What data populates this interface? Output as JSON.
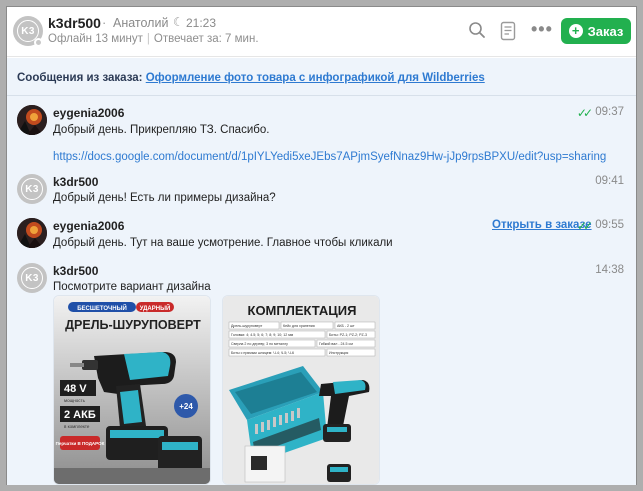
{
  "header": {
    "name": "k3dr500",
    "separator": "·",
    "real_name": "Анатолий",
    "moon_icon": "moon-icon",
    "local_time": "21:23",
    "status": "Офлайн 13 минут",
    "response": "Отвечает за: 7 мин.",
    "avatar_text": "K3",
    "order_button": "Заказ"
  },
  "order_ref": {
    "label": "Сообщения из заказа:",
    "link": "Оформление фото товара с инфографикой для Wildberries"
  },
  "messages": [
    {
      "author": "eygenia2006",
      "time": "09:37",
      "text": "Добрый день. Прикрепляю ТЗ. Спасибо.",
      "link": "https://docs.google.com/document/d/1pIYLYedi5xeJEbs7APjmSyefNnaz9Hw-jJp9rpsBPXU/edit?usp=sharing"
    },
    {
      "author": "k3dr500",
      "avatar_text": "K3",
      "time": "09:41",
      "text": "Добрый день! Есть ли примеры дизайна?"
    },
    {
      "author": "eygenia2006",
      "time": "09:55",
      "open_order": "Открыть в заказе",
      "text": "Добрый день. Тут на ваше усмотрение. Главное чтобы кликали"
    },
    {
      "author": "k3dr500",
      "avatar_text": "K3",
      "time": "14:38",
      "text": "Посмотрите вариант дизайна"
    }
  ],
  "images": {
    "drill": {
      "badge_left": "БЕСШЕТОЧНЫЙ",
      "badge_right": "УДАРНЫЙ",
      "title": "ДРЕЛЬ-ШУРУПОВЕРТ",
      "volt": "48 V",
      "volt_sub": "мощность",
      "akb": "2 АКБ",
      "akb_sub": "в комплекте",
      "plus": "+24",
      "gift": "Перчатки В ПОДАРОК"
    },
    "kit": {
      "title": "КОМПЛЕКТАЦИЯ",
      "rows": [
        [
          "Дрель-шуруповерт",
          "Кейс для хранения",
          "АКБ - 2 шт"
        ],
        [
          "Головки: 4; 4.5; 5; 6; 7; 8; 9; 10; 12 мм",
          "Биты: PZ-1; PZ-2; PZ-3"
        ],
        [
          "Сверла 2 по дереву; 3 по металлу",
          "Гибкий вал - 24.5 см"
        ],
        [
          "Биты с прямым шлицем: Ч-4; Ч-5; Ч-6",
          "Инструкция"
        ]
      ]
    }
  },
  "colors": {
    "accent": "#22b04f",
    "link": "#2e7ad1",
    "chat_bg": "#eef4fb"
  }
}
